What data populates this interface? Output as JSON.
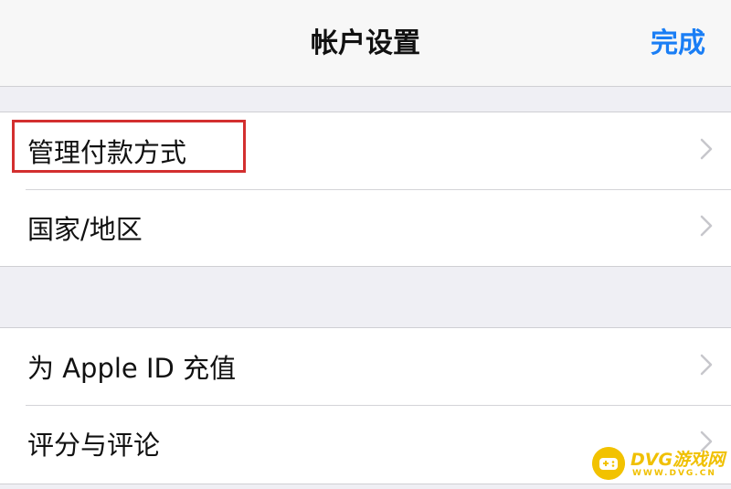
{
  "nav": {
    "title": "帐户设置",
    "done_label": "完成"
  },
  "groups": [
    {
      "rows": [
        {
          "label": "管理付款方式"
        },
        {
          "label": "国家/地区"
        }
      ]
    },
    {
      "rows": [
        {
          "label": "为 Apple ID 充值"
        },
        {
          "label": "评分与评论"
        }
      ]
    }
  ],
  "watermark": {
    "name": "DVG游戏网",
    "url": "WWW.DVG.CN"
  },
  "colors": {
    "accent": "#1a7ef5",
    "highlight": "#d32f2f",
    "background": "#efeff4",
    "watermark": "#f0c000"
  }
}
